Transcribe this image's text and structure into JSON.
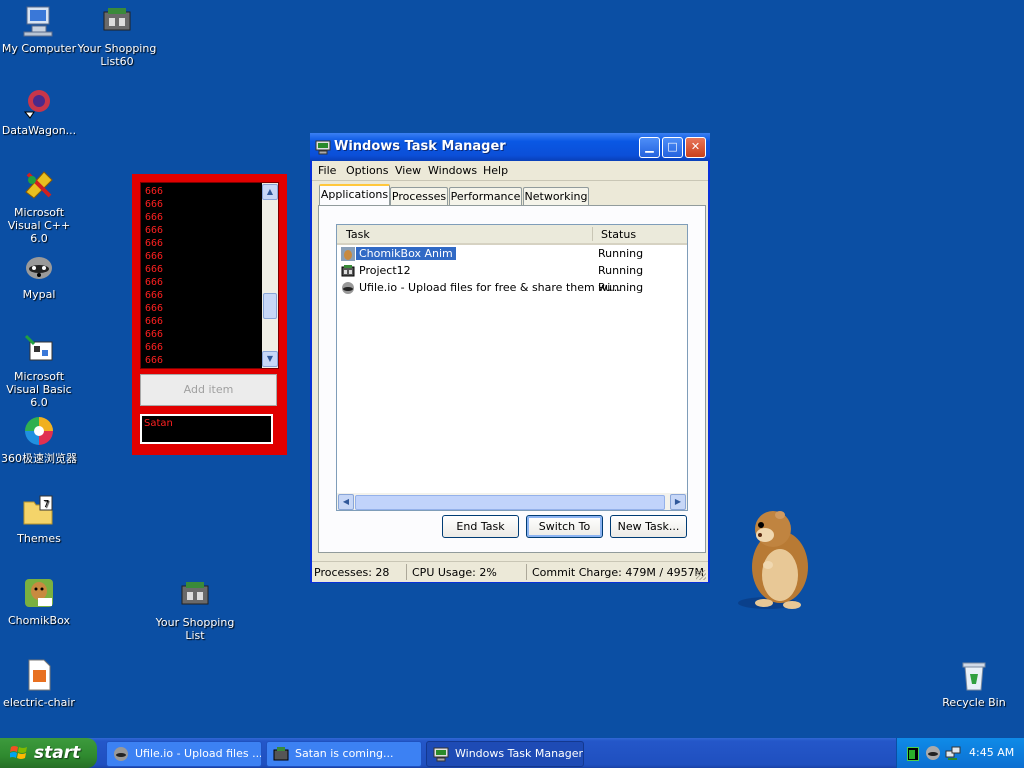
{
  "desktop": {
    "background_color": "#0b4fa4",
    "icons": [
      {
        "label": "My Computer",
        "icon": "computer-icon"
      },
      {
        "label": "Your Shopping List60",
        "icon": "shopping-list-icon"
      },
      {
        "label": "DataWagon...",
        "icon": "datawagon-icon"
      },
      {
        "label": "Microsoft Visual C++ 6.0",
        "icon": "visual-cpp-icon"
      },
      {
        "label": "Mypal",
        "icon": "mypal-icon"
      },
      {
        "label": "Microsoft Visual Basic 6.0",
        "icon": "visual-basic-icon"
      },
      {
        "label": "360极速浏览器",
        "icon": "browser-360-icon"
      },
      {
        "label": "Themes",
        "icon": "folder-icon"
      },
      {
        "label": "ChomikBox",
        "icon": "chomikbox-icon"
      },
      {
        "label": "Your Shopping List",
        "icon": "shopping-list-icon"
      },
      {
        "label": "electric-chair",
        "icon": "file-icon"
      },
      {
        "label": "Recycle Bin",
        "icon": "recycle-bin-icon"
      }
    ]
  },
  "red_app": {
    "list_items": [
      "666",
      "666",
      "666",
      "666",
      "666",
      "666",
      "666",
      "666",
      "666",
      "666",
      "666",
      "666",
      "666",
      "666"
    ],
    "add_button": "Add item",
    "input_value": "Satan"
  },
  "task_manager": {
    "title": "Windows Task Manager",
    "menu": [
      "File",
      "Options",
      "View",
      "Windows",
      "Help"
    ],
    "tabs": [
      "Applications",
      "Processes",
      "Performance",
      "Networking"
    ],
    "active_tab": "Applications",
    "columns": {
      "task": "Task",
      "status": "Status"
    },
    "rows": [
      {
        "task": "ChomikBox Anim",
        "status": "Running",
        "selected": true
      },
      {
        "task": "Project12",
        "status": "Running",
        "selected": false
      },
      {
        "task": "Ufile.io - Upload files for free & share them wi...",
        "status": "Running",
        "selected": false
      }
    ],
    "buttons": {
      "end_task": "End Task",
      "switch_to": "Switch To",
      "new_task": "New Task..."
    },
    "status_bar": {
      "processes": "Processes: 28",
      "cpu": "CPU Usage: 2%",
      "commit": "Commit Charge: 479M / 4957M"
    }
  },
  "taskbar": {
    "start_label": "start",
    "buttons": [
      {
        "label": "Ufile.io - Upload files ...",
        "active": false
      },
      {
        "label": "Satan is coming...",
        "active": false
      },
      {
        "label": "Windows Task Manager",
        "active": true
      }
    ],
    "clock": "4:45 AM"
  }
}
